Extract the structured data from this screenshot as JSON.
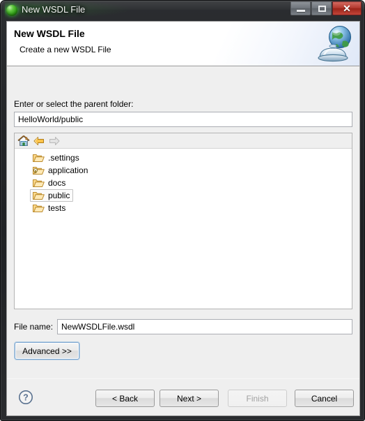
{
  "window": {
    "title": "New WSDL File",
    "app_icon": "green-sphere-icon",
    "controls": {
      "minimize": "minimize-icon",
      "maximize": "maximize-icon",
      "close_label": "✕"
    }
  },
  "banner": {
    "title": "New WSDL File",
    "subtitle": "Create a new WSDL File",
    "icon": "globe-service-bell-icon"
  },
  "form": {
    "parent_folder_label": "Enter or select the parent folder:",
    "parent_folder_value": "HelloWorld/public",
    "parent_folder_placeholder": "",
    "file_name_label": "File name:",
    "file_name_value": "NewWSDLFile.wsdl",
    "file_name_placeholder": "",
    "advanced_label": "Advanced >>"
  },
  "tree": {
    "toolbar": [
      {
        "name": "home-icon",
        "enabled": true
      },
      {
        "name": "back-arrow-icon",
        "enabled": true
      },
      {
        "name": "forward-arrow-icon",
        "enabled": false
      }
    ],
    "items": [
      {
        "label": ".settings",
        "icon": "folder-icon",
        "selected": false,
        "restricted": false
      },
      {
        "label": "application",
        "icon": "folder-locked-icon",
        "selected": false,
        "restricted": true
      },
      {
        "label": "docs",
        "icon": "folder-icon",
        "selected": false,
        "restricted": false
      },
      {
        "label": "public",
        "icon": "folder-icon",
        "selected": true,
        "restricted": false
      },
      {
        "label": "tests",
        "icon": "folder-icon",
        "selected": false,
        "restricted": false
      }
    ]
  },
  "footer": {
    "help_icon": "help-question-icon",
    "buttons": [
      {
        "label": "< Back",
        "enabled": true
      },
      {
        "label": "Next >",
        "enabled": true
      },
      {
        "label": "Finish",
        "enabled": false
      },
      {
        "label": "Cancel",
        "enabled": true
      }
    ]
  },
  "colors": {
    "dialog_bg": "#efefef",
    "banner_bg": "#ffffff",
    "field_border": "#abadb3",
    "focus_ring": "#7aa5cf",
    "folder_fill": "#fcd27f",
    "folder_stroke": "#c08a2e",
    "close_button": "#b43a30",
    "title_bar": "#2b2d30"
  }
}
